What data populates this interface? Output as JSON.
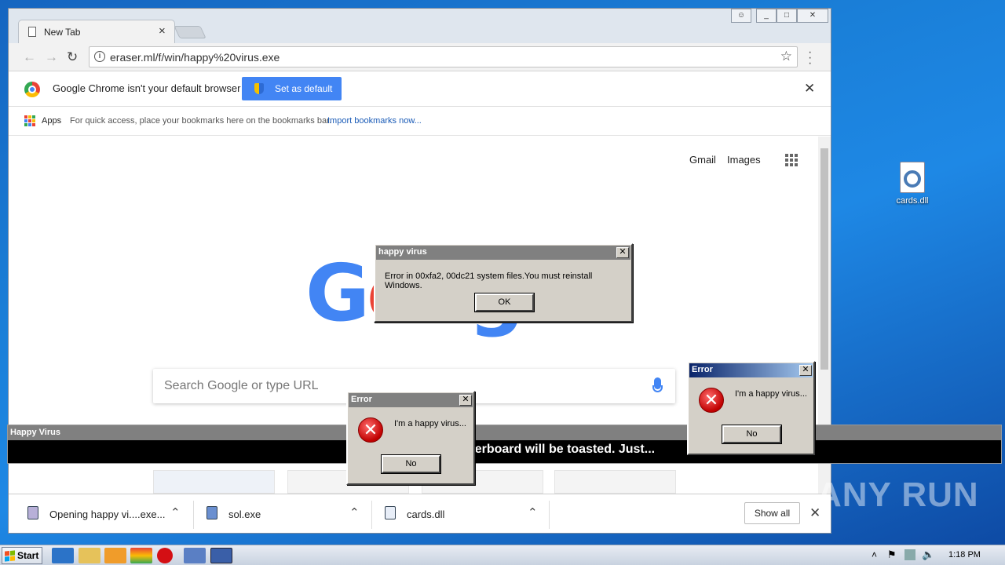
{
  "desktop": {
    "icon_label": "cards.dll"
  },
  "browser": {
    "tab_title": "New Tab",
    "url": "eraser.ml/f/win/happy%20virus.exe",
    "infobar_text": "Google Chrome isn't your default browser",
    "set_default_label": "Set as default",
    "bookmarks": {
      "apps_label": "Apps",
      "hint": "For quick access, place your bookmarks here on the bookmarks bar.",
      "import_link": "Import bookmarks now..."
    },
    "ntp": {
      "gmail": "Gmail",
      "images": "Images",
      "logo_text": "Google",
      "search_placeholder": "Search Google or type URL"
    },
    "downloads": [
      {
        "name": "Opening happy vi....exe...",
        "icon": "archive-icon"
      },
      {
        "name": "sol.exe",
        "icon": "exe-icon"
      },
      {
        "name": "cards.dll",
        "icon": "dll-icon"
      }
    ],
    "show_all_label": "Show all"
  },
  "banner": {
    "title": "Happy Virus",
    "message": "If you restart... motherboard will be toasted. Just..."
  },
  "dialog_main": {
    "title": "happy virus",
    "message": "Error in 00xfa2, 00dc21 system files.You must reinstall Windows.",
    "ok_label": "OK"
  },
  "dialog_error_1": {
    "title": "Error",
    "message": "I'm a happy virus...",
    "no_label": "No"
  },
  "dialog_error_2": {
    "title": "Error",
    "message": "I'm a happy virus...",
    "no_label": "No"
  },
  "taskbar": {
    "start_label": "Start",
    "clock": "1:18 PM"
  },
  "watermark": "ANY RUN",
  "colors": {
    "chrome_blue": "#4285f4",
    "win_title_active": "#0a246a",
    "dialog_gray": "#d4d0c8"
  }
}
